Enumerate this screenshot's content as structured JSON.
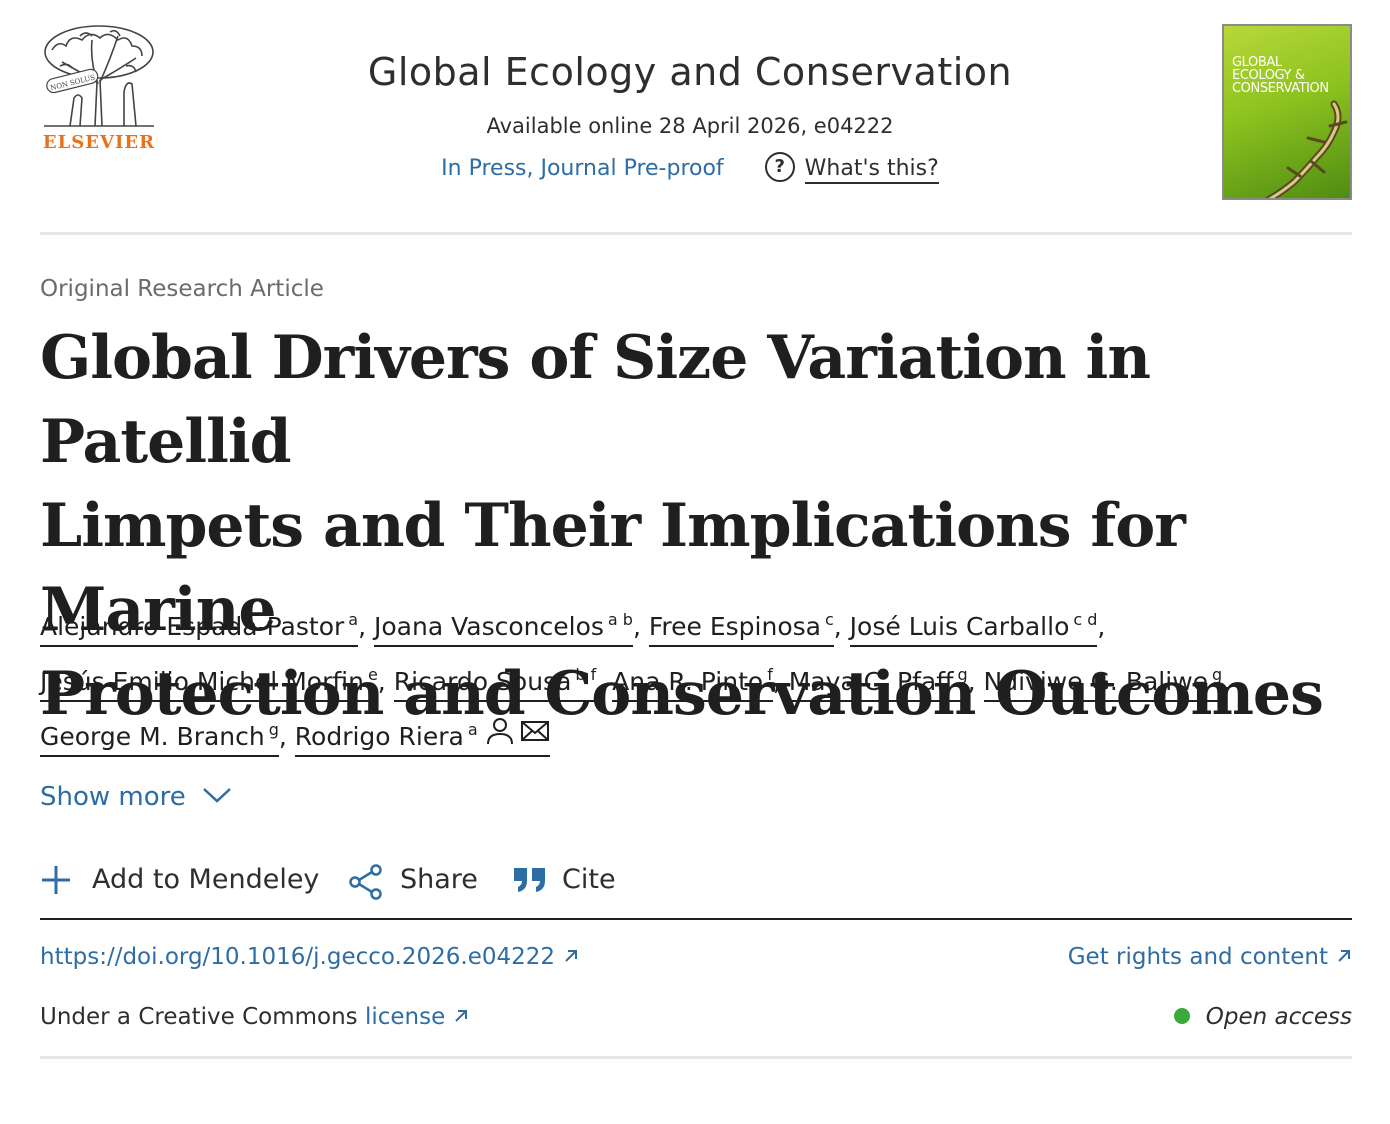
{
  "header": {
    "logo_text": "ELSEVIER",
    "logo_motto": "NON SOLUS",
    "journal_title": "Global Ecology and Conservation",
    "available": "Available online 28 April 2026, e04222",
    "status": "In Press, Journal Pre-proof",
    "whats_this": "What's this?",
    "cover_text": [
      "GLOBAL",
      "ECOLOGY &",
      "CONSERVATION"
    ]
  },
  "article": {
    "type": "Original Research Article",
    "title_lines": [
      "Global Drivers of Size Variation in Patellid",
      "Limpets and Their Implications for Marine",
      "Protection and Conservation Outcomes"
    ],
    "authors": [
      {
        "name": "Alejandro Espada-Pastor",
        "aff": "a"
      },
      {
        "name": "Joana Vasconcelos",
        "aff": "a b"
      },
      {
        "name": "Free Espinosa",
        "aff": "c"
      },
      {
        "name": "José Luis Carballo",
        "aff": "c d"
      },
      {
        "name": "Jesús Emilio Michel Morfin",
        "aff": "e"
      },
      {
        "name": "Ricardo Sousa",
        "aff": "b f"
      },
      {
        "name": "Ana R. Pinto",
        "aff": "f"
      },
      {
        "name": "Maya C. Pfaff",
        "aff": "g"
      },
      {
        "name": "Ndiviwe G. Baliwe",
        "aff": "g"
      },
      {
        "name": "George M. Branch",
        "aff": "g"
      },
      {
        "name": "Rodrigo Riera",
        "aff": "a"
      }
    ],
    "show_more": "Show more"
  },
  "actions": {
    "mendeley": "Add to Mendeley",
    "share": "Share",
    "cite": "Cite"
  },
  "links": {
    "doi": "https://doi.org/10.1016/j.gecco.2026.e04222",
    "rights": "Get rights and content",
    "license_prefix": "Under a Creative Commons",
    "license_link": "license",
    "open_access": "Open access"
  },
  "colors": {
    "link": "#2e6da4",
    "brand_orange": "#e9711c",
    "open_access_dot": "#3aab3a",
    "cover_green": "#8dc21f"
  },
  "icons": [
    "elsevier-tree-logo",
    "question-icon",
    "journal-cover",
    "person-icon",
    "mail-icon",
    "chevron-down-icon",
    "plus-icon",
    "share-icon",
    "quote-icon",
    "external-link-icon"
  ]
}
